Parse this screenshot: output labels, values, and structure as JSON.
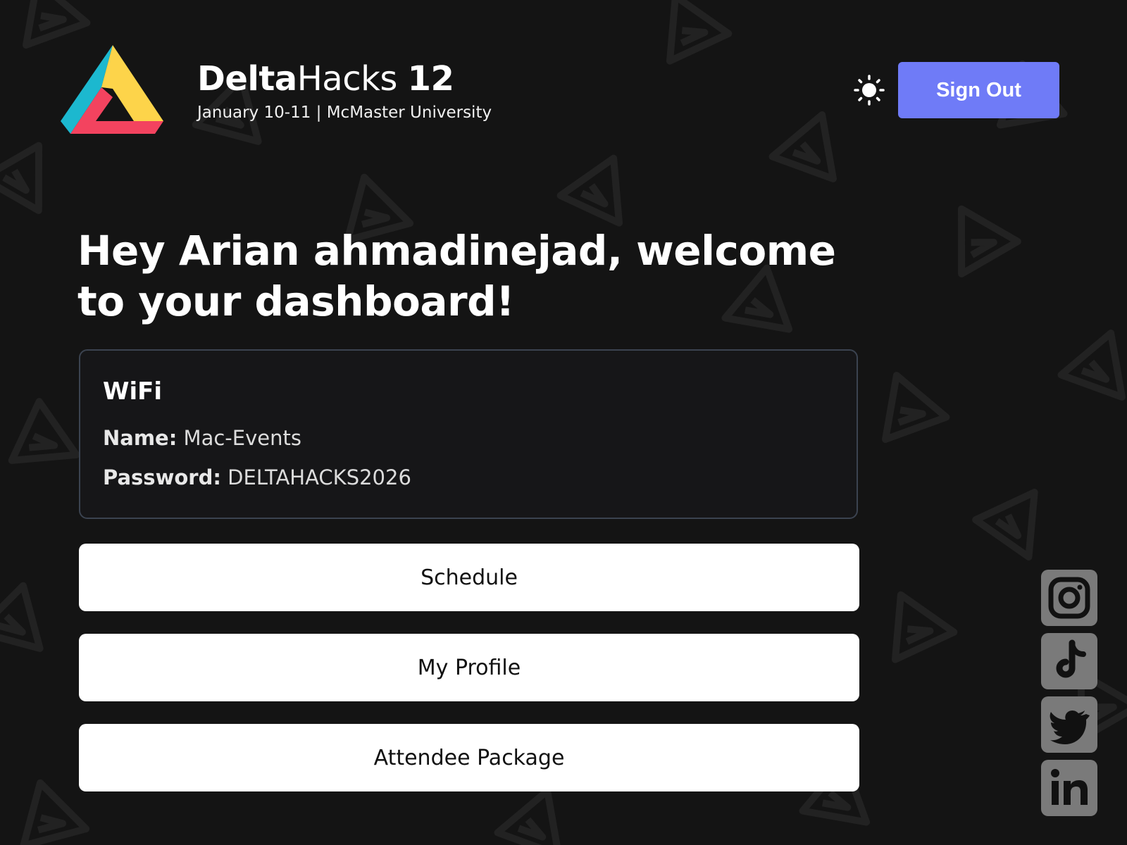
{
  "brand": {
    "name_bold": "Delta",
    "name_regular": "Hacks",
    "edition": "12",
    "subtitle": "January 10-11 | McMaster University",
    "colors": {
      "cyan": "#1cb8cf",
      "yellow": "#fdd44a",
      "pink": "#f3435f"
    }
  },
  "header": {
    "theme_toggle_icon": "sun-icon",
    "signout_label": "Sign Out",
    "accent_color": "#6f7bf7"
  },
  "welcome": {
    "line1": "Hey Arian ahmadinejad, welcome",
    "line2": "to your dashboard!"
  },
  "wifi": {
    "title": "WiFi",
    "name_label": "Name:",
    "name_value": "Mac-Events",
    "password_label": "Password:",
    "password_value": "DELTAHACKS2026"
  },
  "nav": {
    "schedule": "Schedule",
    "profile": "My Profile",
    "package": "Attendee Package"
  },
  "social": [
    {
      "icon": "instagram-icon"
    },
    {
      "icon": "tiktok-icon"
    },
    {
      "icon": "twitter-icon"
    },
    {
      "icon": "linkedin-icon"
    }
  ]
}
